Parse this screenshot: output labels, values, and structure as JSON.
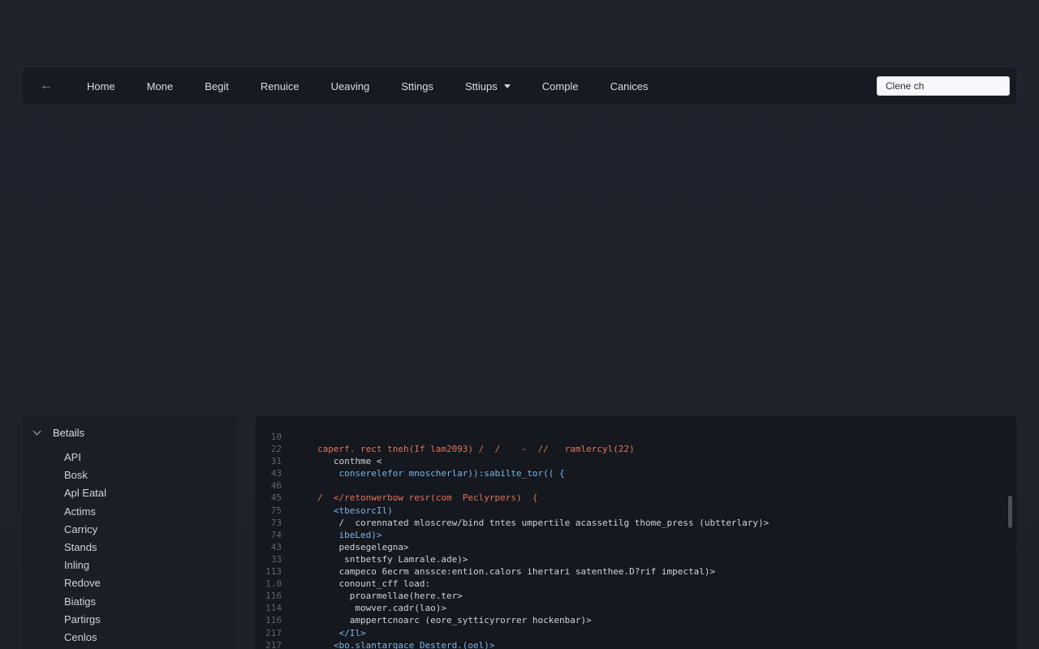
{
  "navbar": {
    "back_icon": "arrow-left-icon",
    "items": [
      "Home",
      "Mone",
      "Begit",
      "Renuice",
      "Ueaving",
      "Sttings",
      "Sttiups",
      "Comple",
      "Canices"
    ],
    "dropdown_item": "Sttiups",
    "search": {
      "value": "Clene ch",
      "placeholder": ""
    }
  },
  "sidebar": {
    "header": "Betails",
    "header_icon": "chevron-down-icon",
    "items": [
      "API",
      "Bosk",
      "Apl Eatal",
      "Actims",
      "Carricy",
      "Stands",
      "Inling",
      "Redove",
      "Biatigs",
      "Partirgs",
      "Cenlos"
    ]
  },
  "code": {
    "lines": [
      {
        "ln": "10",
        "text": ""
      },
      {
        "ln": "22",
        "text": "caperf. rect tneh(If lam2093) /  /    -  //   ramlercyl(22)"
      },
      {
        "ln": "31",
        "text": "   conthme <"
      },
      {
        "ln": "43",
        "text": "    conserelefor mnoscherlar)):sabilte_tor(( {"
      },
      {
        "ln": "46",
        "text": ""
      },
      {
        "ln": "45",
        "text": "/  </retonwerbow resr(com  Peclyrpers)  {"
      },
      {
        "ln": "75",
        "text": "   <tbesorcIl)"
      },
      {
        "ln": "73",
        "text": "    /  corennated mloscrew/bind tntes umpertile acassetilg thome_press (ubtterlary)>"
      },
      {
        "ln": "74",
        "text": "    ibeLed)>"
      },
      {
        "ln": "43",
        "text": "    pedsegelegna>"
      },
      {
        "ln": "33",
        "text": "     sntbetsfy Lamrale.ade)>"
      },
      {
        "ln": "113",
        "text": "    campeco 6ecrm anssce:ention.calors ihertari satenthee.D?rif impectal)>"
      },
      {
        "ln": "1.0",
        "text": "    conount_cff load:"
      },
      {
        "ln": "116",
        "text": "      proarmellae(here.ter>"
      },
      {
        "ln": "114",
        "text": "       mowver.cadr(lao)>"
      },
      {
        "ln": "116",
        "text": "      amppertcnoarc (eore_sytticyrorrer hockenbar)>"
      },
      {
        "ln": "217",
        "text": "    </Il>"
      },
      {
        "ln": "217",
        "text": "   <bo.slantargace Desterd.(oel)>"
      }
    ]
  },
  "colors": {
    "background": "#1e222b",
    "navbar": "#161a21",
    "panel": "#1a1e26",
    "code_bg": "#15181e",
    "keyword": "#e0735a",
    "tag": "#7fb3e6",
    "accent_pink": "#d66bc8"
  }
}
